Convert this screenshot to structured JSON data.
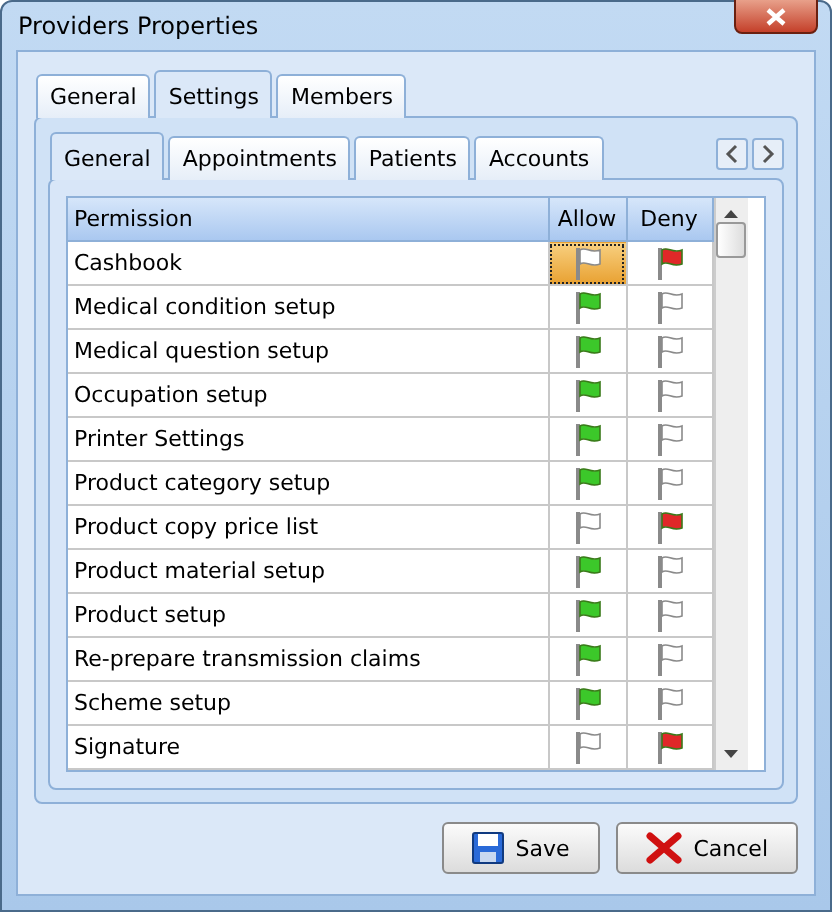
{
  "window": {
    "title": "Providers Properties"
  },
  "tabs": [
    {
      "label": "General",
      "selected": false
    },
    {
      "label": "Settings",
      "selected": true
    },
    {
      "label": "Members",
      "selected": false
    }
  ],
  "subtabs": [
    {
      "label": "General",
      "selected": true
    },
    {
      "label": "Appointments",
      "selected": false
    },
    {
      "label": "Patients",
      "selected": false
    },
    {
      "label": "Accounts",
      "selected": false
    }
  ],
  "table": {
    "columns": [
      "Permission",
      "Allow",
      "Deny"
    ],
    "rows": [
      {
        "permission": "Cashbook",
        "allow": false,
        "deny": true,
        "selected": true
      },
      {
        "permission": "Medical condition setup",
        "allow": true,
        "deny": false,
        "selected": false
      },
      {
        "permission": "Medical question setup",
        "allow": true,
        "deny": false,
        "selected": false
      },
      {
        "permission": "Occupation setup",
        "allow": true,
        "deny": false,
        "selected": false
      },
      {
        "permission": "Printer Settings",
        "allow": true,
        "deny": false,
        "selected": false
      },
      {
        "permission": "Product category setup",
        "allow": true,
        "deny": false,
        "selected": false
      },
      {
        "permission": "Product copy price list",
        "allow": false,
        "deny": true,
        "selected": false
      },
      {
        "permission": "Product material setup",
        "allow": true,
        "deny": false,
        "selected": false
      },
      {
        "permission": "Product setup",
        "allow": true,
        "deny": false,
        "selected": false
      },
      {
        "permission": "Re-prepare transmission claims",
        "allow": true,
        "deny": false,
        "selected": false
      },
      {
        "permission": "Scheme setup",
        "allow": true,
        "deny": false,
        "selected": false
      },
      {
        "permission": "Signature",
        "allow": false,
        "deny": true,
        "selected": false
      }
    ]
  },
  "buttons": [
    {
      "kind": "save",
      "label": "Save"
    },
    {
      "kind": "cancel",
      "label": "Cancel"
    }
  ]
}
